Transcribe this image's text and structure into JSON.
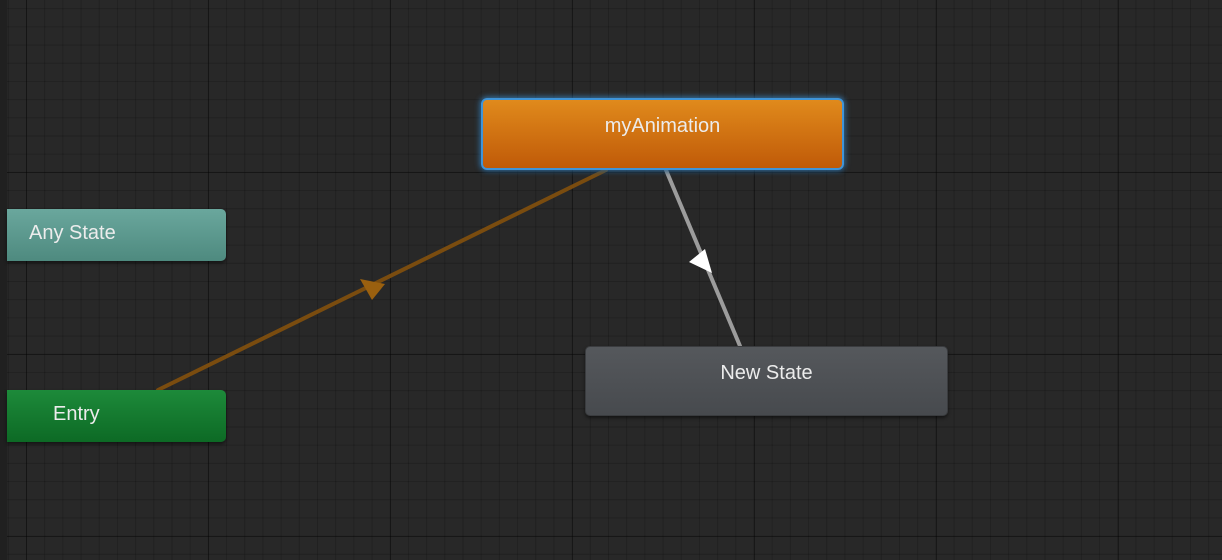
{
  "window": {
    "view": "Animator state machine graph"
  },
  "nodes": {
    "any_state": {
      "label": "Any State",
      "color": "#5e9b91"
    },
    "entry": {
      "label": "Entry",
      "color": "#137a30"
    },
    "my_animation": {
      "label": "myAnimation",
      "color": "#d4741a",
      "selected": true,
      "default_state": true
    },
    "new_state": {
      "label": "New State",
      "color": "#4f5256"
    }
  },
  "transitions": [
    {
      "from": "Entry",
      "to": "myAnimation",
      "kind": "default",
      "color": "#8a5510"
    },
    {
      "from": "myAnimation",
      "to": "New State",
      "kind": "normal",
      "color": "#9a9a9a"
    }
  ],
  "colors": {
    "background": "#282828",
    "selection_outline": "#3f94d8"
  }
}
